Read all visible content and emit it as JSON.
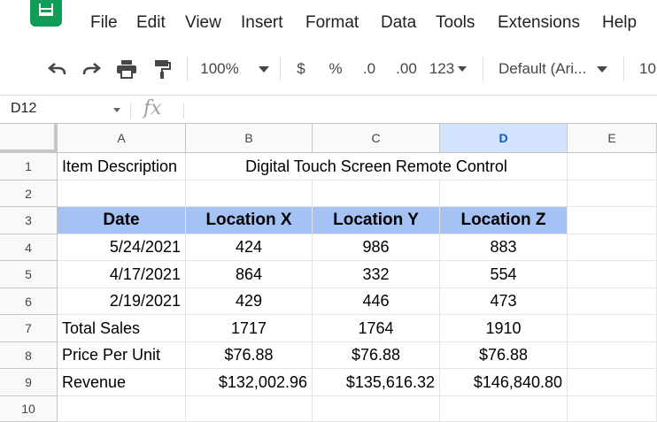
{
  "menu": [
    "File",
    "Edit",
    "View",
    "Insert",
    "Format",
    "Data",
    "Tools",
    "Extensions",
    "Help"
  ],
  "toolbar": {
    "zoom": "100%",
    "currency": "$",
    "percent": "%",
    "decrease_decimal": ".0",
    "increase_decimal": ".00",
    "more_formats": "123",
    "font": "Default (Ari...",
    "font_size": "10"
  },
  "formula_bar": {
    "name_box": "D12",
    "fx": "fx",
    "content": ""
  },
  "columns": [
    "A",
    "B",
    "C",
    "D",
    "E"
  ],
  "rows": [
    "1",
    "2",
    "3",
    "4",
    "5",
    "6",
    "7",
    "8",
    "9",
    "10"
  ],
  "cells": {
    "title_label": "Item Description",
    "title_value": "Digital Touch Screen Remote Control",
    "headers": [
      "Date",
      "Location X",
      "Location Y",
      "Location Z"
    ],
    "data": [
      [
        "5/24/2021",
        "424",
        "986",
        "883"
      ],
      [
        "4/17/2021",
        "864",
        "332",
        "554"
      ],
      [
        "2/19/2021",
        "429",
        "446",
        "473"
      ]
    ],
    "total": [
      "Total Sales",
      "1717",
      "1764",
      "1910"
    ],
    "price": [
      "Price Per Unit",
      "$76.88",
      "$76.88",
      "$76.88"
    ],
    "revenue": [
      "Revenue",
      "$132,002.96",
      "$135,616.32",
      "$146,840.80"
    ]
  },
  "colors": {
    "header_fill": "#a4c2f4",
    "sheets_green": "#0f9d58",
    "selected_col": "#d3e3fd"
  }
}
